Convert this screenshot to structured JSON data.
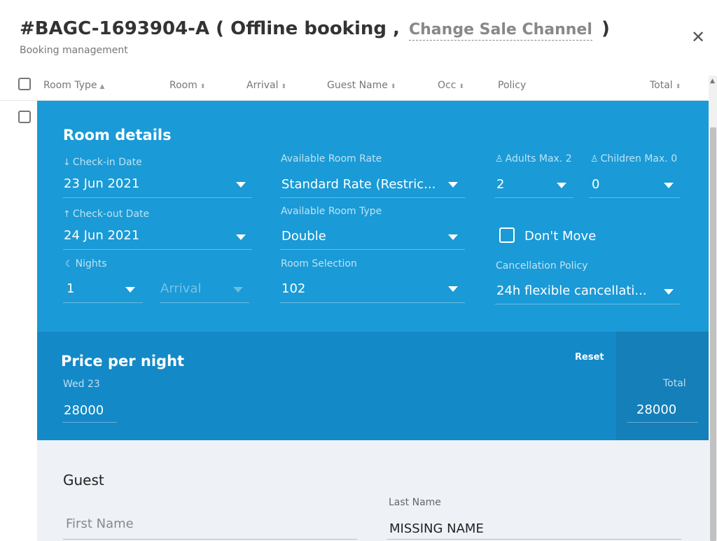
{
  "header": {
    "booking_ref": "#BAGC-1693904-A",
    "paren_open": "(",
    "booking_kind": "Offline booking ,",
    "change_channel": "Change Sale Channel",
    "paren_close": ")",
    "subtitle": "Booking management",
    "close_glyph": "✕"
  },
  "table": {
    "columns": [
      "Room Type",
      "Room",
      "Arrival",
      "Guest Name",
      "Occ",
      "Policy",
      "Total"
    ],
    "sort_up_glyph": "▲",
    "sort_both_glyph": "⬍"
  },
  "room_details": {
    "title": "Room details",
    "checkin_label": "Check-in Date",
    "checkin_value": "23 Jun 2021",
    "checkout_label": "Check-out Date",
    "checkout_value": "24 Jun 2021",
    "nights_label": "Nights",
    "nights_value": "1",
    "arrival_placeholder": "Arrival",
    "rate_label": "Available Room Rate",
    "rate_value": "Standard Rate (Restric...",
    "room_type_label": "Available Room Type",
    "room_type_value": "Double",
    "room_selection_label": "Room Selection",
    "room_selection_value": "102",
    "adults_label": "Adults Max. 2",
    "adults_value": "2",
    "children_label": "Children Max. 0",
    "children_value": "0",
    "dont_move_label": "Don't Move",
    "cancellation_label": "Cancellation Policy",
    "cancellation_value": "24h flexible cancellati...",
    "icons": {
      "checkin": "↓",
      "checkout": "↑",
      "nights": "☾",
      "adults": "♙",
      "children": "♙"
    }
  },
  "price": {
    "title": "Price per night",
    "reset_label": "Reset",
    "day_label": "Wed 23",
    "day_value": "28000",
    "total_label": "Total",
    "total_value": "28000"
  },
  "guest": {
    "title": "Guest",
    "first_name_placeholder": "First Name",
    "last_name_label": "Last Name",
    "last_name_value": "MISSING NAME"
  },
  "colors": {
    "room_panel": "#1a9ad6",
    "price_panel": "#1389c7",
    "total_box": "#147fb8",
    "guest_panel": "#eef2f7"
  }
}
